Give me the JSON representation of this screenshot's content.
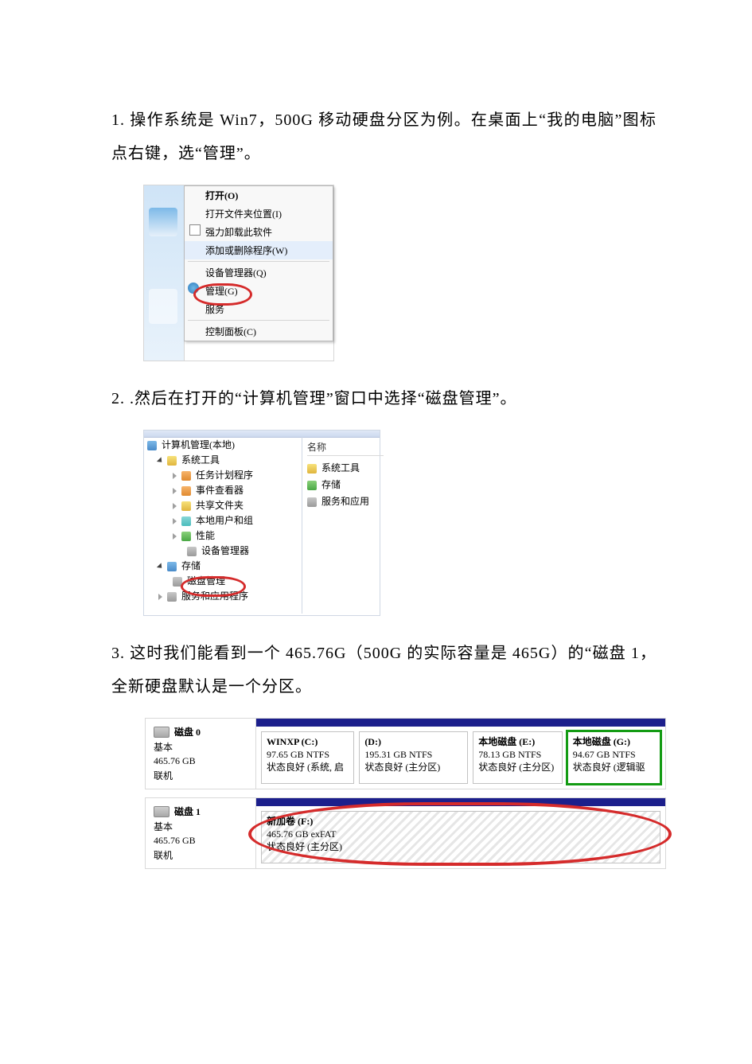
{
  "step1_text": "1. 操作系统是 Win7，500G 移动硬盘分区为例。在桌面上“我的电脑”图标点右键，选“管理”。",
  "step2_text": "2. .然后在打开的“计算机管理”窗口中选择“磁盘管理”。",
  "step3_text": "3. 这时我们能看到一个 465.76G（500G 的实际容量是 465G）的“磁盘 1，全新硬盘默认是一个分区。",
  "ctx": {
    "open": "打开(O)",
    "openfolder": "打开文件夹位置(I)",
    "uninstall": "强力卸载此软件",
    "addremove": "添加或删除程序(W)",
    "devmgr": "设备管理器(Q)",
    "manage": "管理(G)",
    "service": "服务",
    "cpl": "控制面板(C)"
  },
  "mgmt": {
    "root": "计算机管理(本地)",
    "systools": "系统工具",
    "task": "任务计划程序",
    "event": "事件查看器",
    "share": "共享文件夹",
    "users": "本地用户和组",
    "perf": "性能",
    "devmgr": "设备管理器",
    "storage": "存储",
    "diskmgr": "磁盘管理",
    "svc": "服务和应用程序",
    "col_name": "名称",
    "right_sys": "系统工具",
    "right_store": "存储",
    "right_svc": "服务和应用"
  },
  "disk0": {
    "title": "磁盘 0",
    "type": "基本",
    "size": "465.76 GB",
    "state": "联机",
    "p1_title": "WINXP  (C:)",
    "p1_size": "97.65 GB NTFS",
    "p1_state": "状态良好 (系统, 启",
    "p2_title": "(D:)",
    "p2_size": "195.31 GB NTFS",
    "p2_state": "状态良好 (主分区)",
    "p3_title": "本地磁盘  (E:)",
    "p3_size": "78.13 GB NTFS",
    "p3_state": "状态良好 (主分区)",
    "p4_title": "本地磁盘  (G:)",
    "p4_size": "94.67 GB NTFS",
    "p4_state": "状态良好 (逻辑驱"
  },
  "disk1": {
    "title": "磁盘 1",
    "type": "基本",
    "size": "465.76 GB",
    "state": "联机",
    "p1_title": "新加卷  (F:)",
    "p1_size": "465.76 GB exFAT",
    "p1_state": "状态良好 (主分区)"
  }
}
